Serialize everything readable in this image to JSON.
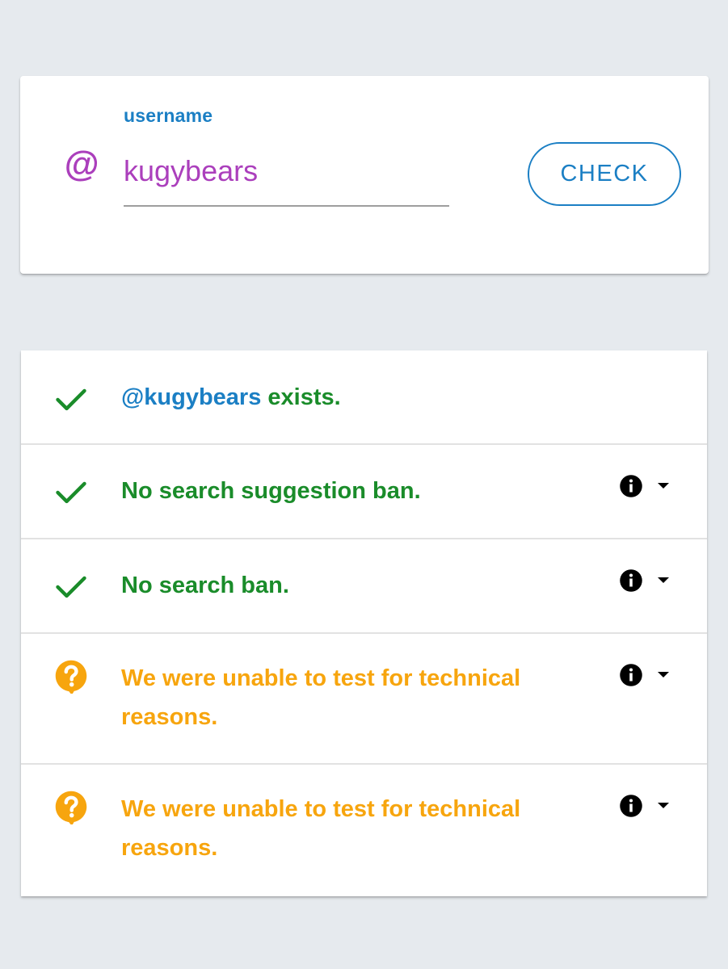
{
  "colors": {
    "accent_blue": "#1b7fc4",
    "purple": "#ab3fbc",
    "success_green": "#1a8c2a",
    "warning_orange": "#f7a50e",
    "info_black": "#000000"
  },
  "search": {
    "at_symbol": "@",
    "label": "username",
    "value": "kugybears",
    "button_label": "CHECK"
  },
  "results": [
    {
      "status": "ok",
      "icon": "checkmark-icon",
      "handle": "@kugybears",
      "text": " exists.",
      "has_info": false
    },
    {
      "status": "ok",
      "icon": "checkmark-icon",
      "text": "No search suggestion ban.",
      "has_info": true
    },
    {
      "status": "ok",
      "icon": "checkmark-icon",
      "text": "No search ban.",
      "has_info": true
    },
    {
      "status": "warning",
      "icon": "question-bubble-icon",
      "text": "We were unable to test for technical reasons.",
      "has_info": true
    },
    {
      "status": "warning",
      "icon": "question-bubble-icon",
      "text": "We were unable to test for technical reasons.",
      "has_info": true
    }
  ]
}
